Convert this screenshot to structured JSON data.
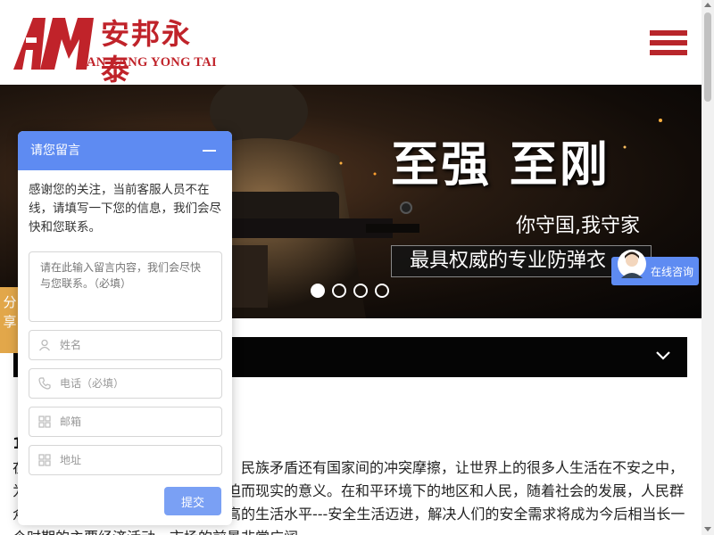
{
  "header": {
    "logo_cn": "安邦永泰",
    "logo_en": "AN BANG YONG TAI",
    "logo_mark_text": "AYT"
  },
  "banner": {
    "slogan": "至强 至刚",
    "sub1": "你守国,我守家",
    "sub2": "最具权威的专业防弹衣",
    "slides": 4,
    "active_slide": 1
  },
  "share_tab": {
    "label": "分享"
  },
  "article": {
    "number": "1",
    "text": "在当今世界，恐怖袭击、种族争斗、民族矛盾还有国家间的冲突摩擦，让世界上的很多人生活在不安之中，为他们提供安全的庇护场所有着紧迫而现实的意义。在和平环境下的地区和人民，随着社会的发展，人民群众已经解决了温饱问题，正在向更高的生活水平---安全生活迈进，解决人们的安全需求将成为今后相当长一个时期的主要经济活动，市场的前景非常广阔。"
  },
  "message_panel": {
    "title": "请您留言",
    "intro": "感谢您的关注，当前客服人员不在线，请填写一下您的信息，我们会尽快和您联系。",
    "textarea_placeholder": "请在此输入留言内容，我们会尽快与您联系。（必填）",
    "fields": [
      {
        "placeholder": "姓名",
        "icon": "person-icon"
      },
      {
        "placeholder": "电话（必填）",
        "icon": "phone-icon"
      },
      {
        "placeholder": "邮箱",
        "icon": "grid-icon"
      },
      {
        "placeholder": "地址",
        "icon": "grid-icon"
      }
    ],
    "submit_label": "提交"
  },
  "consult": {
    "label": "在线咨询"
  },
  "colors": {
    "brand_red": "#c0232a",
    "panel_blue": "#5e8bf2",
    "submit_blue": "#7aa0f4",
    "share_orange": "#e2a74a"
  }
}
